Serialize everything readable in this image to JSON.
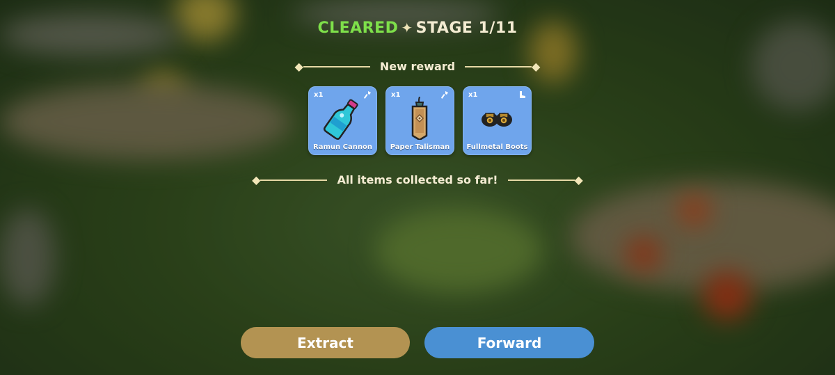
{
  "header": {
    "status": "CLEARED",
    "separator": "✦",
    "stage": "STAGE 1/11"
  },
  "reward_section": {
    "label": "New reward",
    "items": [
      {
        "name": "Ramun Cannon",
        "quantity": "x1",
        "icon": "bottle-icon",
        "type_icon": "axe-icon"
      },
      {
        "name": "Paper Talisman",
        "quantity": "x1",
        "icon": "talisman-icon",
        "type_icon": "axe-icon"
      },
      {
        "name": "Fullmetal Boots",
        "quantity": "x1",
        "icon": "boots-icon",
        "type_icon": "boot-type-icon"
      }
    ]
  },
  "collected_label": "All items collected so far!",
  "buttons": {
    "extract": "Extract",
    "forward": "Forward"
  },
  "colors": {
    "cleared": "#7ee04a",
    "card": "#6fa5ec",
    "extract": "#b39352",
    "forward": "#4a90d3"
  }
}
